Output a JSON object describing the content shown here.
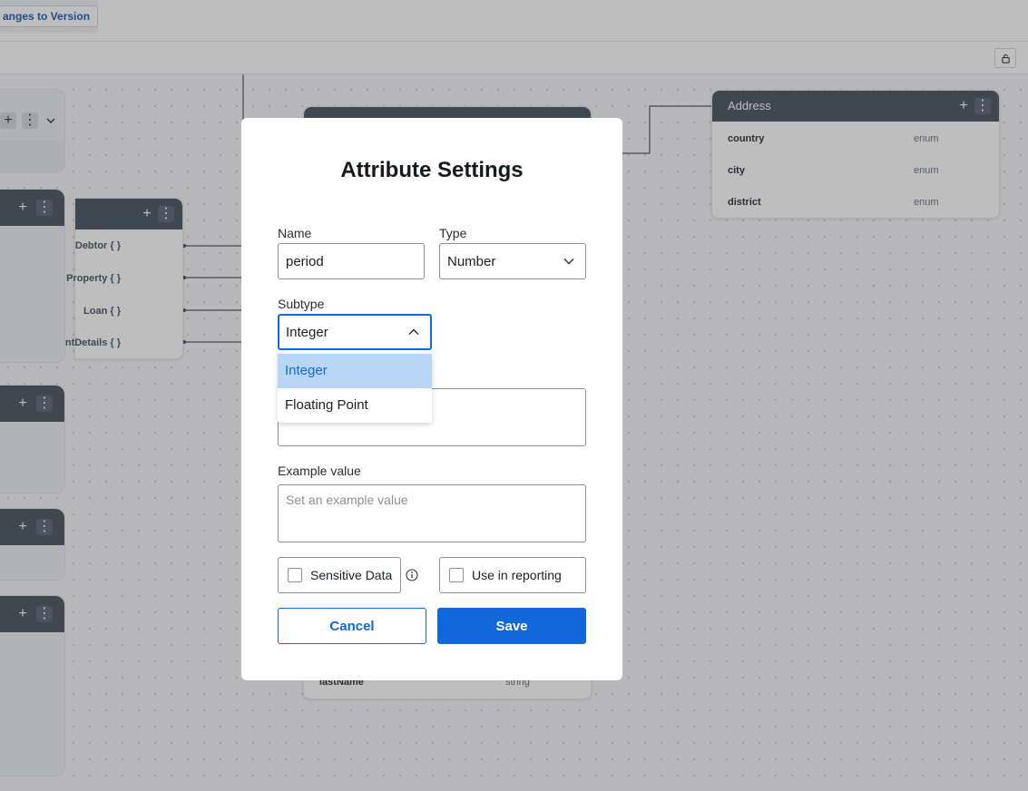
{
  "toolbar": {
    "version_button_label": "anges to Version"
  },
  "canvas": {
    "left_entity": {
      "links": [
        "Debtor { }",
        "Property { }",
        "Loan { }",
        "ntDetails { }"
      ]
    },
    "address_entity": {
      "title": "Address",
      "attributes": [
        {
          "name": "country",
          "type": "enum"
        },
        {
          "name": "city",
          "type": "enum"
        },
        {
          "name": "district",
          "type": "enum"
        }
      ]
    },
    "bottom_entity": {
      "attributes": [
        {
          "name": "lastName",
          "type": "string"
        }
      ]
    }
  },
  "modal": {
    "title": "Attribute Settings",
    "name_label": "Name",
    "name_value": "period",
    "type_label": "Type",
    "type_value": "Number",
    "subtype_label": "Subtype",
    "subtype_value": "Integer",
    "subtype_options": [
      "Integer",
      "Floating Point"
    ],
    "example_label": "Example value",
    "example_placeholder": "Set an example value",
    "sensitive_label": "Sensitive Data",
    "reporting_label": "Use in reporting",
    "cancel_label": "Cancel",
    "save_label": "Save",
    "accent_color": "#1168d9"
  }
}
